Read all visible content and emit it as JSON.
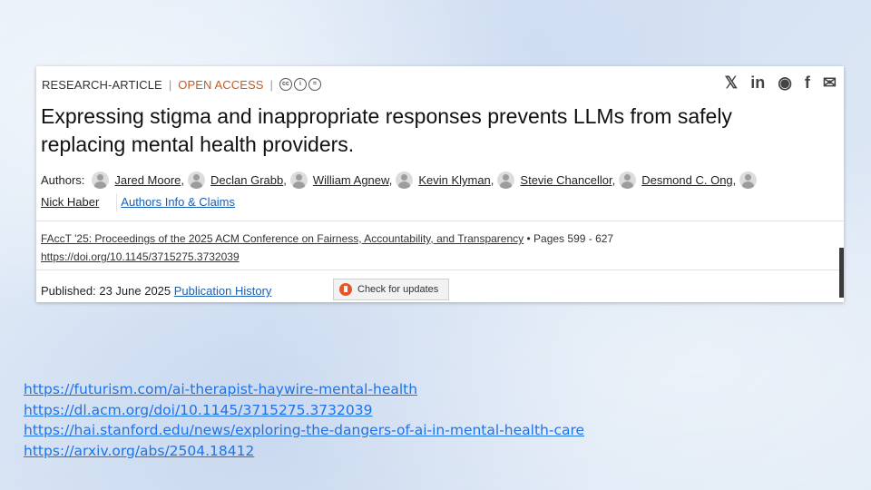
{
  "article": {
    "type": "RESEARCH-ARTICLE",
    "access": "OPEN ACCESS",
    "license_icons": [
      "cc",
      "by",
      "nd"
    ],
    "share_icons": [
      "x-icon",
      "linkedin-icon",
      "reddit-icon",
      "facebook-icon",
      "email-icon"
    ],
    "share_glyphs": [
      "𝕏",
      "in",
      "◉",
      "f",
      "✉"
    ],
    "title": "Expressing stigma and inappropriate responses prevents LLMs from safely replacing mental health providers.",
    "authors_label": "Authors:",
    "authors": [
      "Jared Moore",
      "Declan Grabb",
      "William Agnew",
      "Kevin Klyman",
      "Stevie Chancellor",
      "Desmond C. Ong",
      "Nick Haber"
    ],
    "authors_info_link": "Authors Info & Claims",
    "venue": "FAccT '25: Proceedings of the 2025 ACM Conference on Fairness, Accountability, and Transparency",
    "pages": "Pages 599 - 627",
    "doi": "https://doi.org/10.1145/3715275.3732039",
    "published_label": "Published",
    "published_date": "23 June 2025",
    "publication_history_link": "Publication History",
    "check_updates_label": "Check for updates"
  },
  "links": [
    "https://futurism.com/ai-therapist-haywire-mental-health",
    "https://dl.acm.org/doi/10.1145/3715275.3732039",
    "https://hai.stanford.edu/news/exploring-the-dangers-of-ai-in-mental-health-care",
    "https://arxiv.org/abs/2504.18412"
  ],
  "colors": {
    "open_access": "#c45d1c",
    "link_blue": "#1a5fb4",
    "slide_link": "#1e73e8",
    "background": "#dde8f5"
  }
}
